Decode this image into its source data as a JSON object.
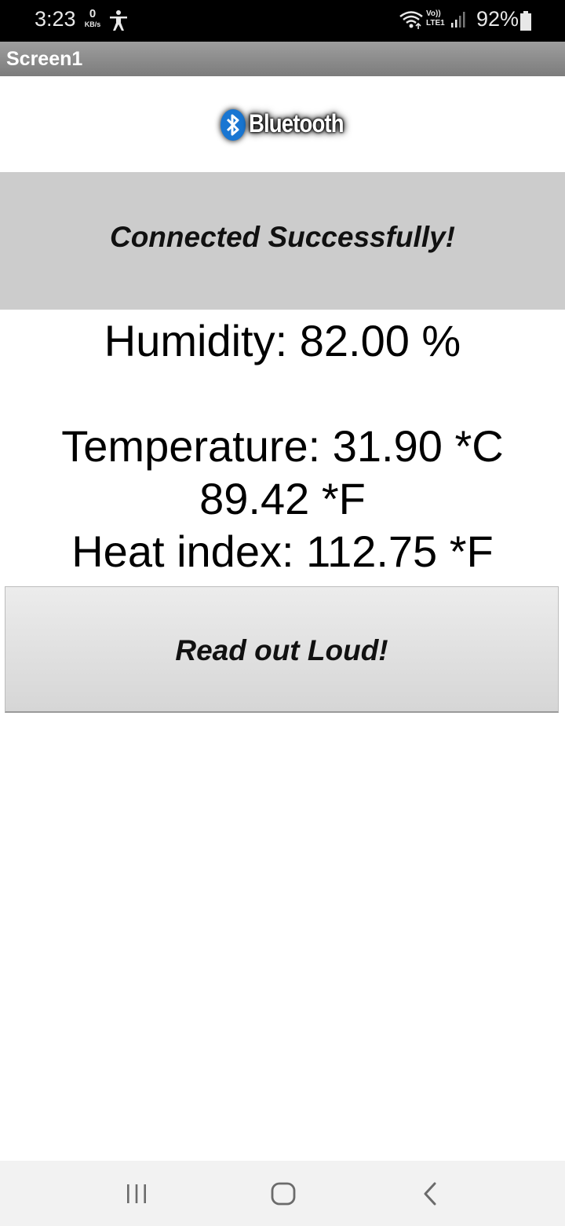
{
  "status_bar": {
    "time": "3:23",
    "net_speed_value": "0",
    "net_speed_unit": "KB/s",
    "network_label_top": "Vo))",
    "network_label_bottom": "LTE1",
    "battery": "92%"
  },
  "title_bar": {
    "title": "Screen1"
  },
  "logo": {
    "text": "Bluetooth",
    "accent_color": "#1976d2"
  },
  "status_panel": {
    "message": "Connected Successfully!"
  },
  "readings": {
    "humidity": "Humidity: 82.00 %",
    "temperature_c": "Temperature: 31.90 *C",
    "temperature_f": "89.42 *F",
    "heat_index": "Heat index: 112.75 *F"
  },
  "read_button": {
    "label": "Read out Loud!"
  },
  "nav_bar": {
    "icons": [
      "recents-icon",
      "home-icon",
      "back-icon"
    ]
  }
}
